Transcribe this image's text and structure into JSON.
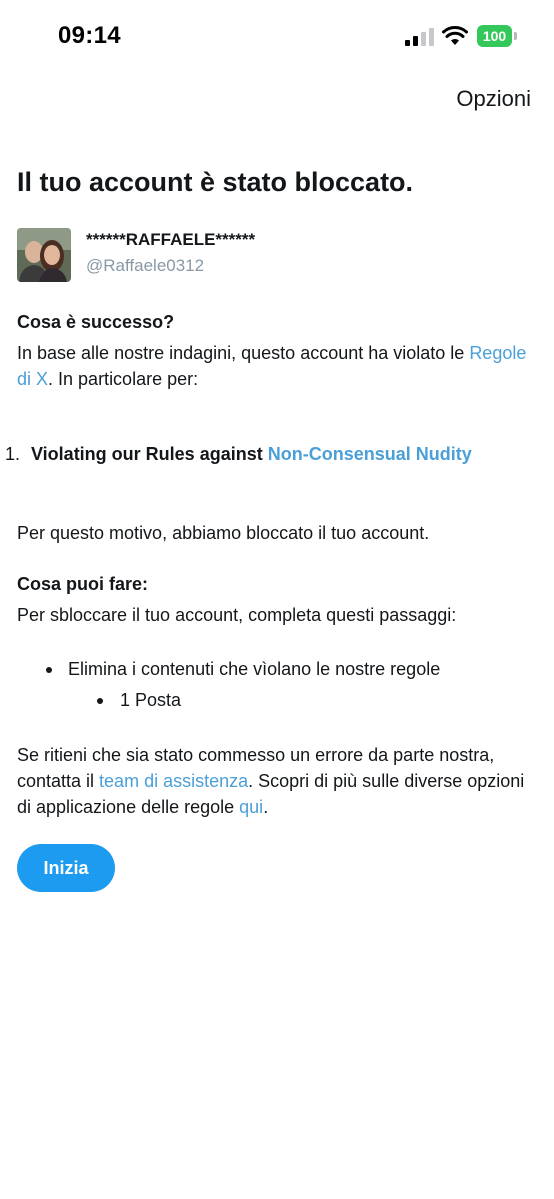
{
  "status_bar": {
    "time": "09:14",
    "battery": "100"
  },
  "header": {
    "options_label": "Opzioni"
  },
  "title": "Il tuo account è stato bloccato.",
  "account": {
    "display_name": "******RAFFAELE******",
    "handle": "@Raffaele0312"
  },
  "what_happened": {
    "heading": "Cosa è successo?",
    "text_before_link": "In base alle nostre indagini, questo account ha violato le ",
    "link": "Regole di X",
    "text_after_link": ". In particolare per:"
  },
  "violations": [
    {
      "number": "1.",
      "text": "Violating our Rules against ",
      "link": "Non-Consensual Nudity"
    }
  ],
  "reason": "Per questo motivo, abbiamo bloccato il tuo account.",
  "what_to_do": {
    "heading": "Cosa puoi fare:",
    "intro": "Per sbloccare il tuo account, completa questi passaggi:",
    "steps": [
      {
        "text": "Elimina i contenuti che vìolano le nostre regole",
        "sub_items": [
          "1 Posta"
        ]
      }
    ]
  },
  "appeal": {
    "text1": "Se ritieni che sia stato commesso un errore da parte nostra, contatta il ",
    "link1": "team di assistenza",
    "text2": ". Scopri di più sulle diverse opzioni di applicazione delle regole ",
    "link2": "qui",
    "text3": "."
  },
  "start_button": "Inizia",
  "colors": {
    "link": "#4a9fd8",
    "button": "#1d9bf0",
    "battery": "#34c759",
    "secondary_text": "#8899a6"
  }
}
